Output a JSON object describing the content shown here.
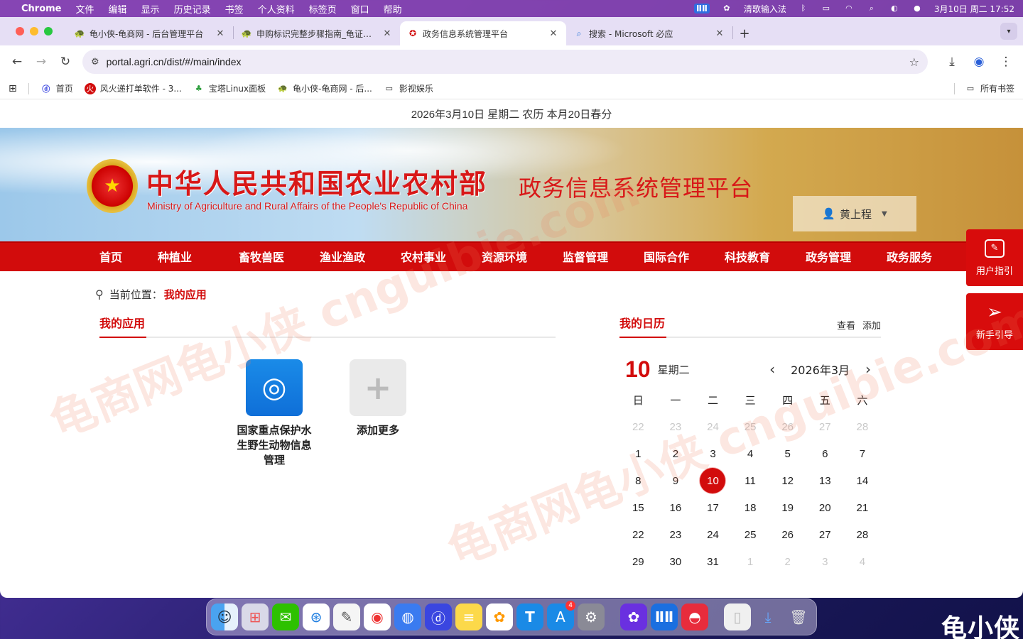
{
  "menubar": {
    "app_name": "Chrome",
    "items": [
      "文件",
      "编辑",
      "显示",
      "历史记录",
      "书签",
      "个人资料",
      "标签页",
      "窗口",
      "帮助"
    ],
    "ime": "清歌输入法",
    "datetime": "3月10日 周二  17:52"
  },
  "tabs": [
    {
      "title": "龟小侠-龟商网 - 后台管理平台",
      "active": false
    },
    {
      "title": "申购标识完整步骤指南_龟证标识",
      "active": false
    },
    {
      "title": "政务信息系统管理平台",
      "active": true
    },
    {
      "title": "搜索 - Microsoft 必应",
      "active": false
    }
  ],
  "address": {
    "url": "portal.agri.cn/dist/#/main/index"
  },
  "bookmarks": {
    "items": [
      "首页",
      "风火递打单软件 - 3...",
      "宝塔Linux面板",
      "龟小侠-龟商网 - 后...",
      "影视娱乐"
    ],
    "all_bookmarks": "所有书签"
  },
  "page": {
    "date_line": "2026年3月10日 星期二 农历 本月20日春分",
    "ministry_cn": "中华人民共和国农业农村部",
    "ministry_en": "Ministry of Agriculture and Rural Affairs of the People's Republic of China",
    "platform_title": "政务信息系统管理平台",
    "user_name": "黄上程",
    "nav": [
      "首页",
      "种植业",
      "畜牧兽医",
      "渔业渔政",
      "农村事业",
      "资源环境",
      "监督管理",
      "国际合作",
      "科技教育",
      "政务管理",
      "政务服务"
    ],
    "side_buttons": [
      "用户指引",
      "新手引导"
    ],
    "breadcrumb_label": "当前位置：",
    "breadcrumb_current": "我的应用",
    "apps_title": "我的应用",
    "apps": [
      {
        "label": "国家重点保护水生野生动物信息管理"
      },
      {
        "label": "添加更多"
      }
    ],
    "calendar": {
      "title": "我的日历",
      "view": "查看",
      "add": "添加",
      "big_day": "10",
      "weekday": "星期二",
      "month_label": "2026年3月",
      "weekdays": [
        "日",
        "一",
        "二",
        "三",
        "四",
        "五",
        "六"
      ],
      "today": "10",
      "days": [
        [
          "22",
          "m"
        ],
        [
          "23",
          "m"
        ],
        [
          "24",
          "m"
        ],
        [
          "25",
          "m"
        ],
        [
          "26",
          "m"
        ],
        [
          "27",
          "m"
        ],
        [
          "28",
          "m"
        ],
        [
          "1",
          ""
        ],
        [
          "2",
          ""
        ],
        [
          "3",
          ""
        ],
        [
          "4",
          ""
        ],
        [
          "5",
          ""
        ],
        [
          "6",
          ""
        ],
        [
          "7",
          ""
        ],
        [
          "8",
          ""
        ],
        [
          "9",
          ""
        ],
        [
          "10",
          "t"
        ],
        [
          "11",
          ""
        ],
        [
          "12",
          ""
        ],
        [
          "13",
          ""
        ],
        [
          "14",
          ""
        ],
        [
          "15",
          ""
        ],
        [
          "16",
          ""
        ],
        [
          "17",
          ""
        ],
        [
          "18",
          ""
        ],
        [
          "19",
          ""
        ],
        [
          "20",
          ""
        ],
        [
          "21",
          ""
        ],
        [
          "22",
          ""
        ],
        [
          "23",
          ""
        ],
        [
          "24",
          ""
        ],
        [
          "25",
          ""
        ],
        [
          "26",
          ""
        ],
        [
          "27",
          ""
        ],
        [
          "28",
          ""
        ],
        [
          "29",
          ""
        ],
        [
          "30",
          ""
        ],
        [
          "31",
          ""
        ],
        [
          "1",
          "m"
        ],
        [
          "2",
          "m"
        ],
        [
          "3",
          "m"
        ],
        [
          "4",
          "m"
        ]
      ]
    }
  },
  "watermark": {
    "text_a": "龟商网龟小侠 cnguibie.com",
    "text_b": "龟商网龟小侠 cnguibie.com"
  },
  "brand_mark": "龟小侠",
  "colors": {
    "accent_red": "#d20c0c",
    "menubar": "#8c46b4"
  }
}
